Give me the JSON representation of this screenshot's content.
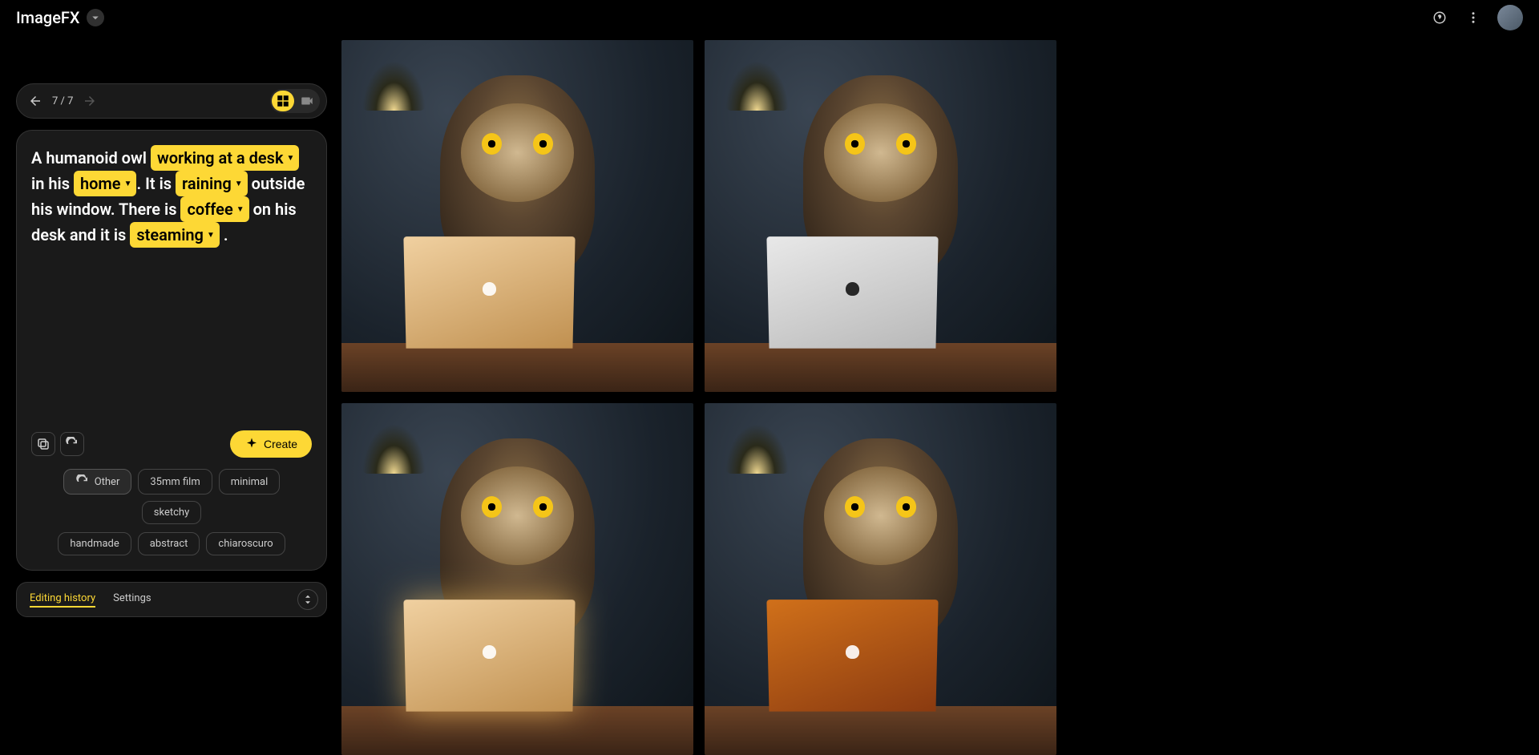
{
  "app": {
    "name": "ImageFX"
  },
  "nav": {
    "counter": "7 / 7"
  },
  "prompt": {
    "parts": [
      {
        "text": "A humanoid owl ",
        "chip": false
      },
      {
        "text": "working at a desk",
        "chip": true
      },
      {
        "text": " in his ",
        "chip": false
      },
      {
        "text": "home",
        "chip": true
      },
      {
        "text": ". It is ",
        "chip": false
      },
      {
        "text": "raining",
        "chip": true
      },
      {
        "text": " outside his window. There is ",
        "chip": false
      },
      {
        "text": "coffee",
        "chip": true
      },
      {
        "text": " on his desk and it is ",
        "chip": false
      },
      {
        "text": "steaming",
        "chip": true
      },
      {
        "text": " .",
        "chip": false
      }
    ]
  },
  "create_label": "Create",
  "styles": {
    "primary": "Other",
    "row1": [
      "35mm film",
      "minimal",
      "sketchy"
    ],
    "row2": [
      "handmade",
      "abstract",
      "chiaroscuro"
    ]
  },
  "tabs": {
    "editing_history": "Editing history",
    "settings": "Settings"
  }
}
